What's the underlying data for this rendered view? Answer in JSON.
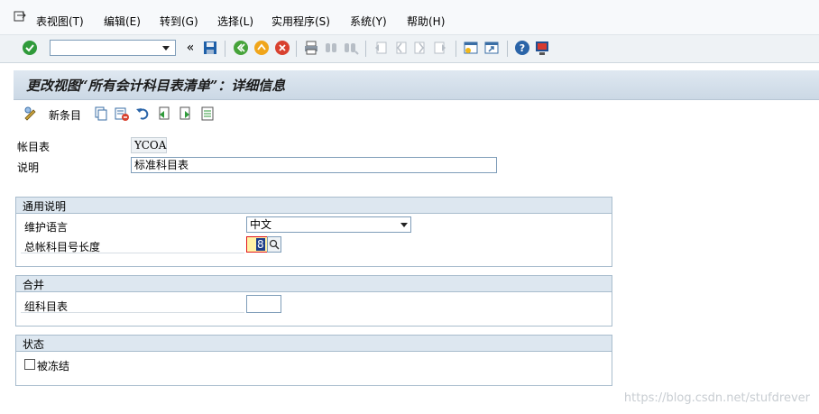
{
  "menubar": {
    "items": [
      "表视图(T)",
      "编辑(E)",
      "转到(G)",
      "选择(L)",
      "实用程序(S)",
      "系统(Y)",
      "帮助(H)"
    ]
  },
  "toolbar": {
    "command_field_value": "",
    "icons": [
      "enter-icon",
      "command-dropdown-icon",
      "collapse-icon",
      "save-icon",
      "back-icon",
      "exit-icon",
      "cancel-icon",
      "print-icon",
      "find-icon",
      "find-next-icon",
      "first-page-icon",
      "previous-page-icon",
      "next-page-icon",
      "last-page-icon",
      "create-session-icon",
      "shortcut-icon",
      "help-icon",
      "customize-layout-icon"
    ]
  },
  "title": "更改视图“所有会计科目表清单”：详细信息",
  "app_toolbar": {
    "new_entries_label": "新条目"
  },
  "header_fields": {
    "chart_label": "帐目表",
    "chart_value": "YCOA",
    "description_label": "说明",
    "description_value": "标准科目表"
  },
  "groups": {
    "general": {
      "title": "通用说明",
      "language_label": "维护语言",
      "language_value": "中文",
      "gl_length_label": "总帐科目号长度",
      "gl_length_value": "8"
    },
    "consolidation": {
      "title": "合并",
      "group_chart_label": "组科目表",
      "group_chart_value": ""
    },
    "status": {
      "title": "状态",
      "blocked_label": "被冻结",
      "blocked_checked": false
    }
  },
  "watermark": "https://blog.csdn.net/stufdrever",
  "colors": {
    "title_bar": "#cbd8e5",
    "group_header": "#dde7f0",
    "focus_field": "#fff3a6",
    "focus_border": "#e0161b"
  }
}
